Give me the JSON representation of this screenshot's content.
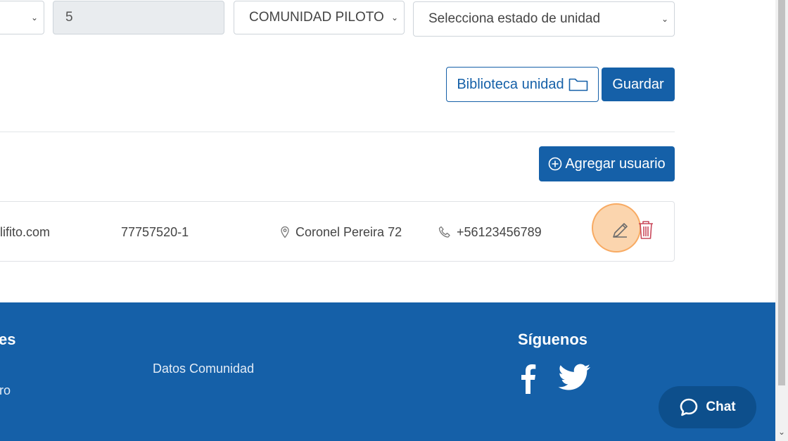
{
  "filters": {
    "select_partial_value": "",
    "number_value": "5",
    "community_select": "COMUNIDAD PILOTO",
    "unit_state_select": "Selecciona estado de unidad"
  },
  "actions": {
    "library_label": "Biblioteca unidad",
    "save_label": "Guardar",
    "add_user_label": "Agregar usuario"
  },
  "user_row": {
    "email": "lifito.com",
    "rut": "77757520-1",
    "address": "Coronel Pereira 72",
    "phone": "+56123456789"
  },
  "footer": {
    "col1_heading_partial": "es",
    "col1_link_partial": "ro",
    "col2_link": "Datos Comunidad",
    "social_heading": "Síguenos",
    "social_icons": [
      "facebook-icon",
      "twitter-icon"
    ]
  },
  "chat": {
    "label": "Chat"
  },
  "colors": {
    "primary": "#1560a8",
    "footer_bg": "#1560a8",
    "delete": "#c9485b",
    "highlight": "#f7b26c"
  }
}
